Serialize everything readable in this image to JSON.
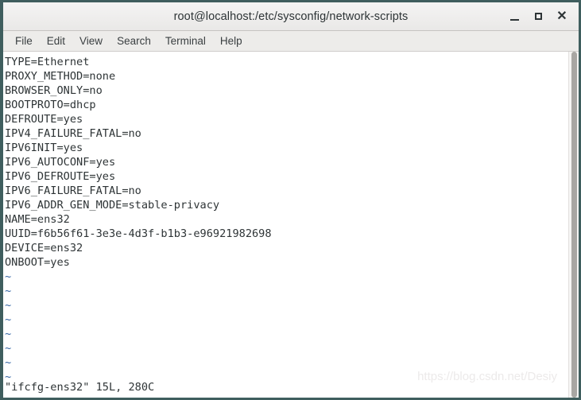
{
  "window": {
    "title": "root@localhost:/etc/sysconfig/network-scripts",
    "controls": {
      "minimize": "minimize-icon",
      "maximize": "maximize-icon",
      "close": "close-icon"
    }
  },
  "menubar": {
    "items": [
      {
        "label": "File"
      },
      {
        "label": "Edit"
      },
      {
        "label": "View"
      },
      {
        "label": "Search"
      },
      {
        "label": "Terminal"
      },
      {
        "label": "Help"
      }
    ]
  },
  "terminal": {
    "lines": [
      "TYPE=Ethernet",
      "PROXY_METHOD=none",
      "BROWSER_ONLY=no",
      "BOOTPROTO=dhcp",
      "DEFROUTE=yes",
      "IPV4_FAILURE_FATAL=no",
      "IPV6INIT=yes",
      "IPV6_AUTOCONF=yes",
      "IPV6_DEFROUTE=yes",
      "IPV6_FAILURE_FATAL=no",
      "IPV6_ADDR_GEN_MODE=stable-privacy",
      "NAME=ens32",
      "UUID=f6b56f61-3e3e-4d3f-b1b3-e96921982698",
      "DEVICE=ens32",
      "ONBOOT=yes"
    ],
    "empty_markers": [
      "~",
      "~",
      "~",
      "~",
      "~",
      "~",
      "~",
      "~"
    ],
    "status_line": "\"ifcfg-ens32\" 15L, 280C",
    "colors": {
      "text": "#2e3436",
      "tilde": "#3465a4",
      "background": "#ffffff"
    }
  },
  "watermark": {
    "text": "https://blog.csdn.net/Desiy"
  }
}
